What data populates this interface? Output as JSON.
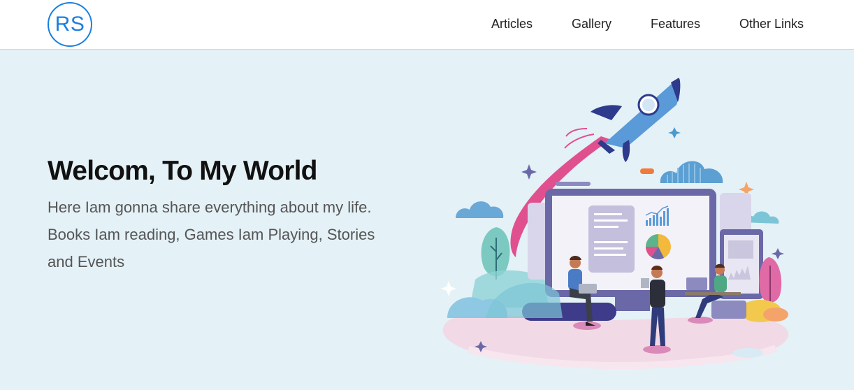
{
  "brand": {
    "logo_text": "RS"
  },
  "nav": {
    "items": [
      {
        "label": "Articles"
      },
      {
        "label": "Gallery"
      },
      {
        "label": "Features"
      },
      {
        "label": "Other Links"
      }
    ]
  },
  "hero": {
    "title": "Welcom, To My World",
    "text": "Here Iam gonna share everything about my life. Books Iam reading, Games Iam Playing, Stories and Events"
  },
  "colors": {
    "logo_blue": "#1a7fe0",
    "hero_bg": "#e4f1f7",
    "monitor_frame": "#6b68a8",
    "rocket_blue": "#5a9ad8",
    "rocket_trail": "#e0508f"
  },
  "icons": [
    "rocket-icon",
    "monitor-icon",
    "pie-chart-icon",
    "bar-chart-icon",
    "cloud-icon",
    "sparkle-icon",
    "person-icon"
  ]
}
